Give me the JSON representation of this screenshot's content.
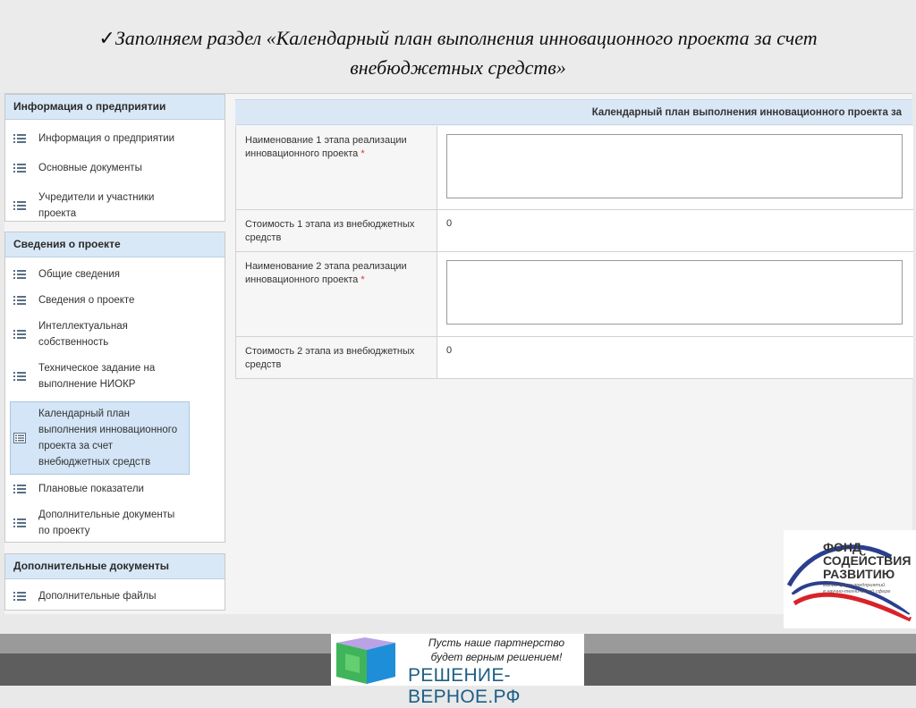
{
  "slide": {
    "check_mark": "✓",
    "title_line1": "Заполняем раздел «Календарный план выполнения инновационного проекта за счет",
    "title_line2": "внебюджетных средств»"
  },
  "sidebar": {
    "sections": [
      {
        "header": "Информация о предприятии",
        "items": [
          "Информация о предприятии",
          "Основные документы",
          "Учредители и участники проекта"
        ]
      },
      {
        "header": "Сведения о проекте",
        "items": [
          "Общие сведения",
          "Сведения о проекте",
          "Интеллектуальная собственность",
          "Техническое задание на выполнение НИОКР",
          "Календарный план выполнения инновационного проекта за счет внебюджетных средств",
          "Плановые показатели",
          "Дополнительные документы по проекту"
        ]
      },
      {
        "header": "Дополнительные документы",
        "items": [
          "Дополнительные файлы"
        ]
      }
    ]
  },
  "content": {
    "header": "Календарный план выполнения инновационного проекта за",
    "required_mark": "*",
    "fields": [
      {
        "label": "Наименование 1 этапа реализации инновационного проекта",
        "value": ""
      },
      {
        "label": "Стоимость 1 этапа из внебюджетных средств",
        "value": "0"
      },
      {
        "label": "Наименование 2 этапа реализации инновационного проекта",
        "value": ""
      },
      {
        "label": "Стоимость 2 этапа из внебюджетных средств",
        "value": "0"
      }
    ]
  },
  "logo_fund": {
    "line1": "ФОНД",
    "line2": "СОДЕЙСТВИЯ",
    "line3": "РАЗВИТИЮ",
    "line4": "малых форм предприятий",
    "line5": "в научно-технической сфере"
  },
  "banner": {
    "slogan_line1": "Пусть наше партнерство",
    "slogan_line2": "будет верным решением!",
    "site": "РЕШЕНИЕ-ВЕРНОЕ.РФ"
  },
  "colors": {
    "panel_header_bg": "#d9e8f6",
    "active_item_bg": "#d3e5f6",
    "required": "#dd3333",
    "flag_blue": "#2b3f8f",
    "flag_red": "#d8232a",
    "site_blue": "#1d5f86"
  }
}
